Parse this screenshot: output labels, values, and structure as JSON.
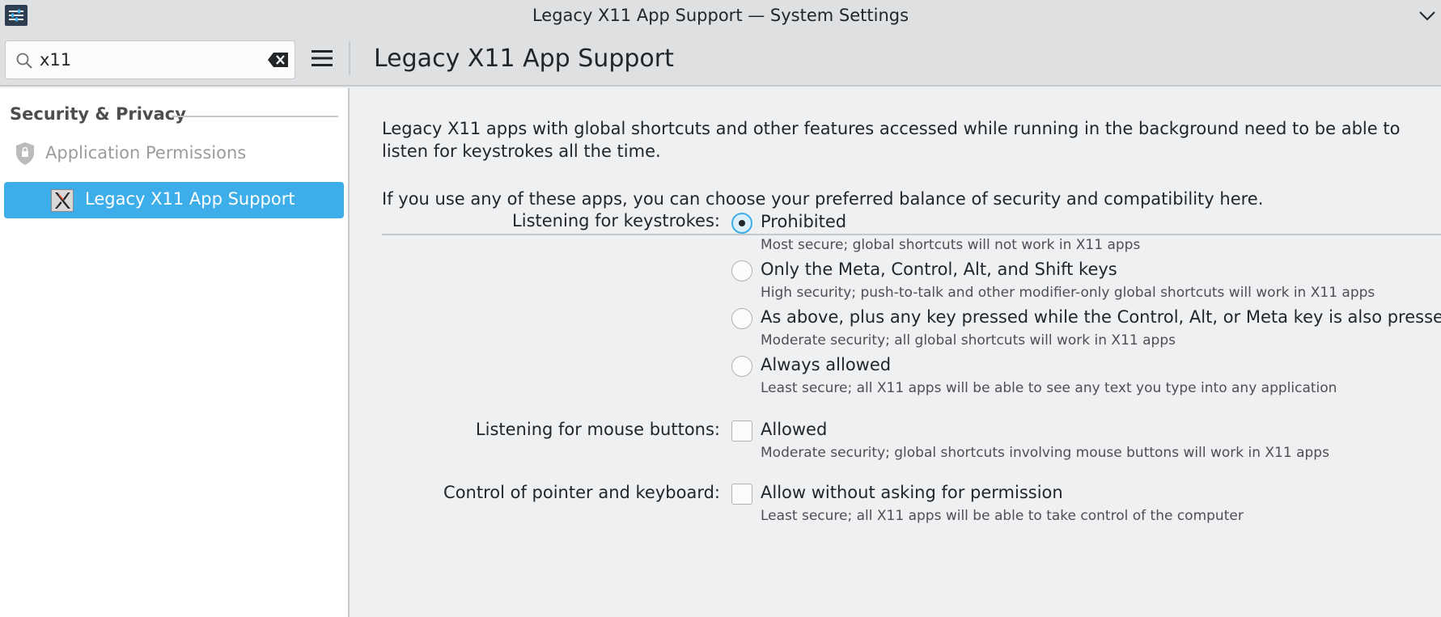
{
  "window": {
    "title": "Legacy X11 App Support — System Settings"
  },
  "icons": {
    "app": "settings-sliders-icon",
    "titlebar_menu": "chevron-down-icon",
    "search": "search-icon",
    "clear": "backspace-clear-icon",
    "menu": "hamburger-menu-icon",
    "permissions": "shield-icon",
    "x11": "x11-logo-icon"
  },
  "search": {
    "value": "x11",
    "placeholder": ""
  },
  "header": {
    "title": "Legacy X11 App Support"
  },
  "sidebar": {
    "section": "Security & Privacy",
    "parent": "Application Permissions",
    "selected": "Legacy X11 App Support"
  },
  "main": {
    "description1": "Legacy X11 apps with global shortcuts and other features accessed while running in the background need to be able to listen for keystrokes all the time.",
    "description2": "If you use any of these apps, you can choose your preferred balance of security and compatibility here.",
    "keystrokes": {
      "label": "Listening for keystrokes:",
      "options": [
        {
          "label": "Prohibited",
          "desc": "Most secure; global shortcuts will not work in X11 apps",
          "checked": true
        },
        {
          "label": "Only the Meta, Control, Alt, and Shift keys",
          "desc": "High security; push-to-talk and other modifier-only global shortcuts will work in X11 apps",
          "checked": false
        },
        {
          "label": "As above, plus any key pressed while the Control, Alt, or Meta key is also pressed",
          "desc": "Moderate security; all global shortcuts will work in X11 apps",
          "checked": false
        },
        {
          "label": "Always allowed",
          "desc": "Least secure; all X11 apps will be able to see any text you type into any application",
          "checked": false
        }
      ]
    },
    "mouse": {
      "label": "Listening for mouse buttons:",
      "option": {
        "label": "Allowed",
        "desc": "Moderate security; global shortcuts involving mouse buttons will work in X11 apps",
        "checked": false
      }
    },
    "pointer": {
      "label": "Control of pointer and keyboard:",
      "option": {
        "label": "Allow without asking for permission",
        "desc": "Least secure; all X11 apps will be able to take control of the computer",
        "checked": false
      }
    }
  },
  "colors": {
    "accent": "#3daee9",
    "window_bg": "#eff0f1",
    "header_bg": "#dee0e2",
    "sidebar_bg": "#ffffff"
  }
}
